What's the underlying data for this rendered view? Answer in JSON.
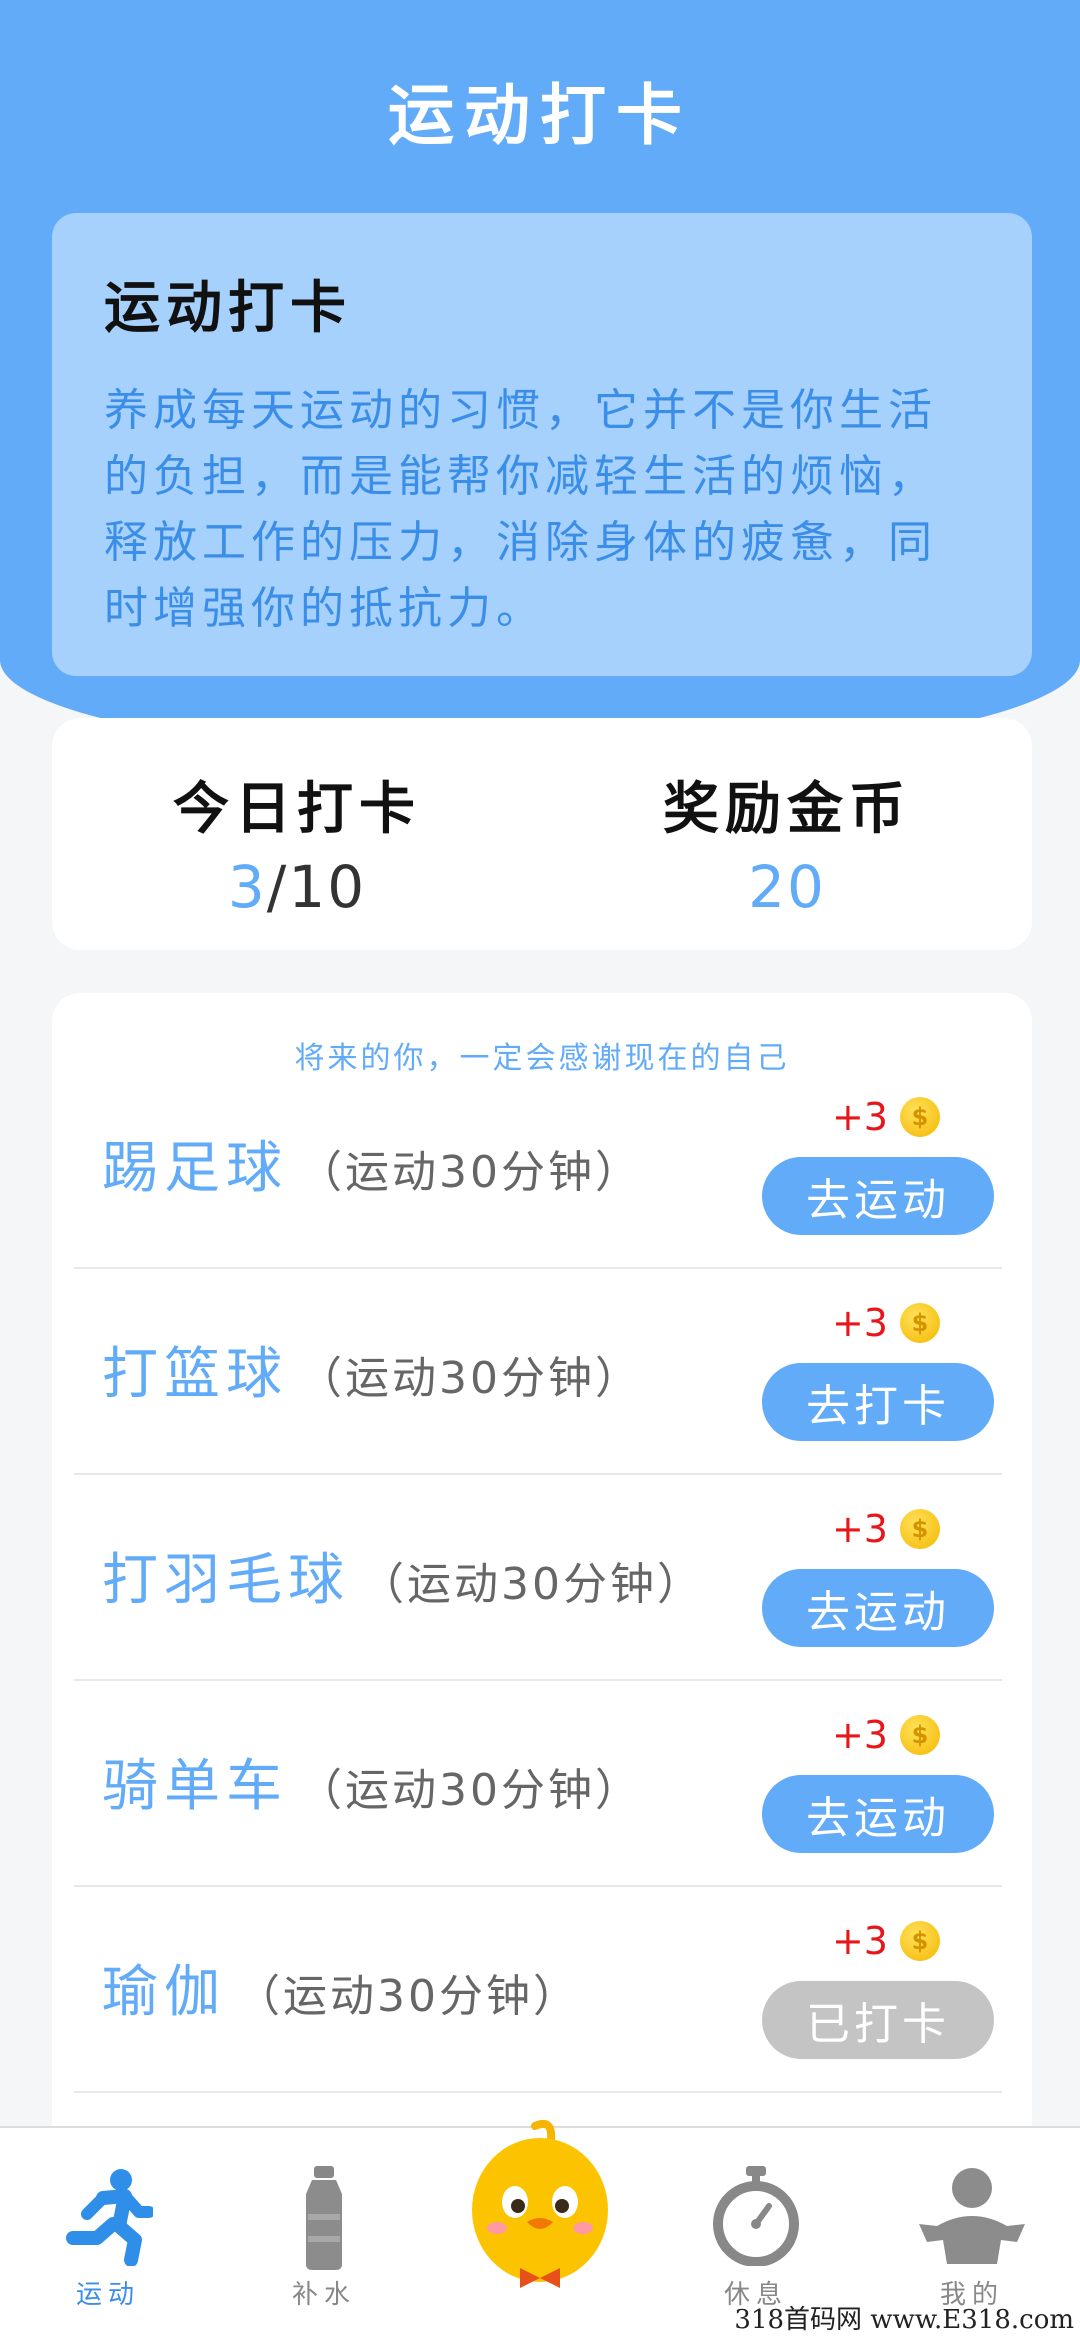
{
  "header": {
    "title": "运动打卡"
  },
  "intro": {
    "title": "运动打卡",
    "text": "养成每天运动的习惯，它并不是你生活的负担，而是能帮你减轻生活的烦恼，释放工作的压力，消除身体的疲惫，同时增强你的抵抗力。"
  },
  "stats": {
    "today_label": "今日打卡",
    "today_done": "3",
    "today_total": "/10",
    "reward_label": "奖励金币",
    "reward_value": "20"
  },
  "list": {
    "motto": "将来的你，一定会感谢现在的自己",
    "items": [
      {
        "name": "踢足球",
        "sub": "（运动30分钟）",
        "reward": "+3",
        "button": "去运动",
        "done": false
      },
      {
        "name": "打篮球",
        "sub": "（运动30分钟）",
        "reward": "+3",
        "button": "去打卡",
        "done": false
      },
      {
        "name": "打羽毛球",
        "sub": "（运动30分钟）",
        "reward": "+3",
        "button": "去运动",
        "done": false
      },
      {
        "name": "骑单车",
        "sub": "（运动30分钟）",
        "reward": "+3",
        "button": "去运动",
        "done": false
      },
      {
        "name": "瑜伽",
        "sub": "（运动30分钟）",
        "reward": "+3",
        "button": "已打卡",
        "done": true
      }
    ]
  },
  "tabbar": {
    "tabs": [
      {
        "label": "运动",
        "icon": "running-person-icon",
        "active": true
      },
      {
        "label": "补水",
        "icon": "water-bottle-icon",
        "active": false
      },
      {
        "label": "",
        "icon": "duck-mascot-icon",
        "active": false
      },
      {
        "label": "休息",
        "icon": "stopwatch-icon",
        "active": false
      },
      {
        "label": "我的",
        "icon": "person-icon",
        "active": false
      }
    ]
  },
  "watermark": "318首码网 www.E318.com",
  "colors": {
    "primary": "#62abf8",
    "intro_bg": "#a6d1fd",
    "reward_red": "#e8161a",
    "done_gray": "#c4c4c4"
  }
}
